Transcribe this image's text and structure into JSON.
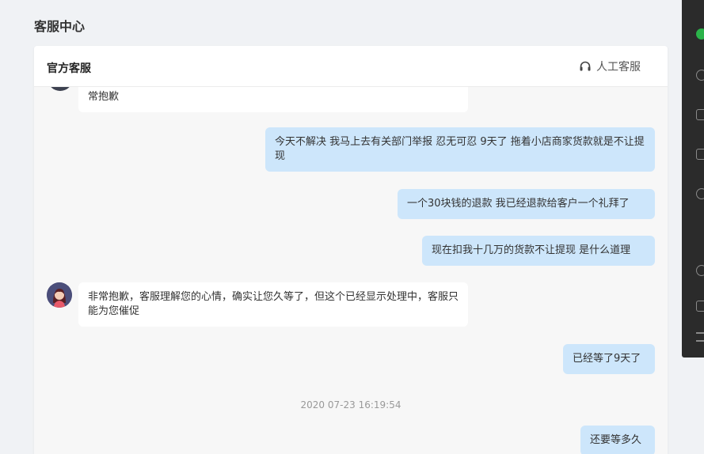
{
  "page": {
    "title": "客服中心"
  },
  "panel": {
    "title": "官方客服",
    "human_agent_label": "人工客服"
  },
  "messages": [
    {
      "from": "agent",
      "text": "常抱歉"
    },
    {
      "from": "user",
      "text": "今天不解决 我马上去有关部门举报 忍无可忍 9天了 拖着小店商家货款就是不让提现"
    },
    {
      "from": "user",
      "text": "一个30块钱的退款 我已经退款给客户一个礼拜了"
    },
    {
      "from": "user",
      "text": "现在扣我十几万的货款不让提现 是什么道理"
    },
    {
      "from": "agent",
      "text": "非常抱歉，客服理解您的心情，确实让您久等了，但这个已经显示处理中，客服只能为您催促"
    },
    {
      "from": "user",
      "text": "已经等了9天了"
    },
    {
      "from": "user",
      "text": "还要等多久"
    }
  ],
  "timestamp": "2020 07-23 16:19:54",
  "icons": {
    "human_agent": "headset-icon",
    "agent_avatar": "agent-avatar"
  },
  "colors": {
    "user_bubble": "#cde6fb",
    "agent_bubble": "#ffffff",
    "page_bg": "#f0f2f5",
    "chat_bg": "#f7f7f7"
  }
}
